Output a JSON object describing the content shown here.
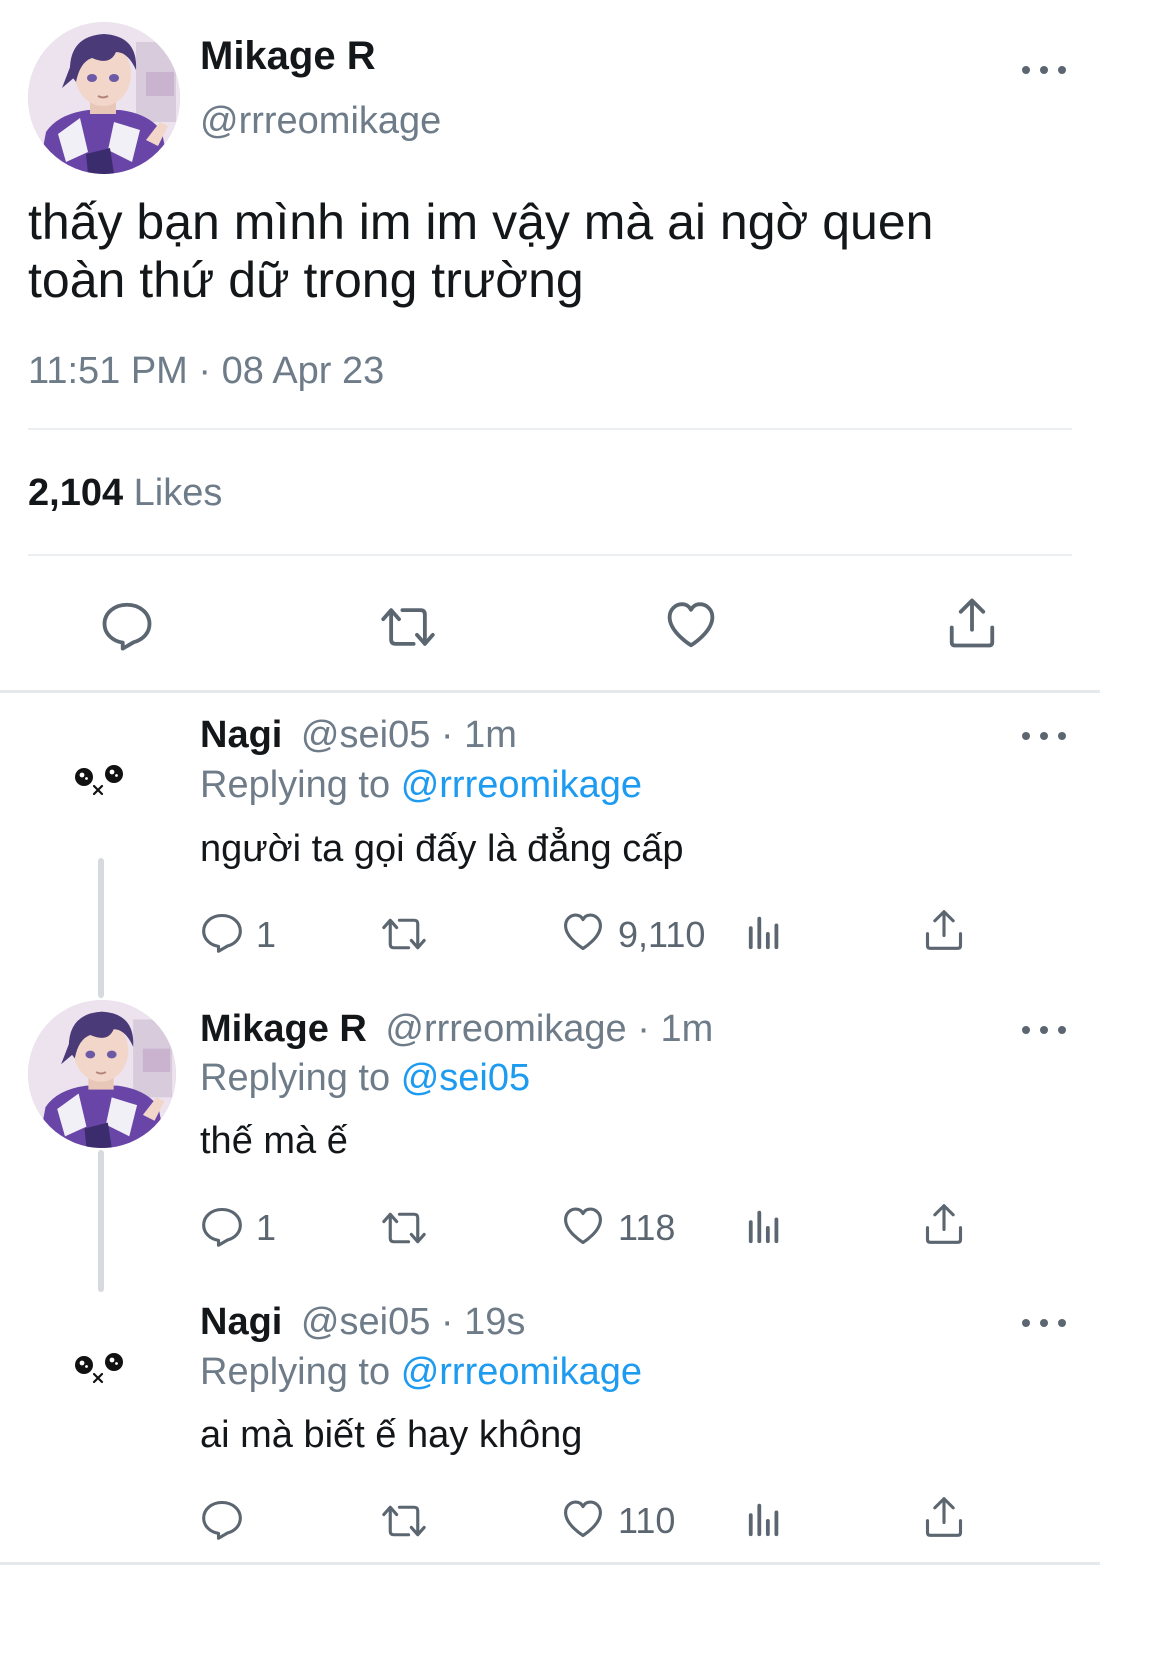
{
  "main_tweet": {
    "display_name": "Mikage R",
    "handle": "@rrreomikage",
    "text_line1": "thấy bạn mình im im vậy mà ai ngờ quen",
    "text_line2": "toàn thứ dữ trong trường",
    "timestamp": "11:51 PM · 08 Apr 23",
    "likes_count": "2,104",
    "likes_label": "Likes"
  },
  "replies": [
    {
      "display_name": "Nagi",
      "meta": "@sei05 · 1m",
      "replying_prefix": "Replying to",
      "replying_handle": "@rrreomikage",
      "text": "người ta gọi đấy là đẳng cấp",
      "reply_count": "1",
      "like_count": "9,110"
    },
    {
      "display_name": "Mikage R",
      "meta": "@rrreomikage · 1m",
      "replying_prefix": "Replying to",
      "replying_handle": "@sei05",
      "text": "thế mà ế",
      "reply_count": "1",
      "like_count": "118"
    },
    {
      "display_name": "Nagi",
      "meta": "@sei05 · 19s",
      "replying_prefix": "Replying to",
      "replying_handle": "@rrreomikage",
      "text": "ai mà biết ế hay không",
      "reply_count": "",
      "like_count": "110"
    }
  ],
  "colors": {
    "link_blue": "#1d9bf0",
    "secondary_gray": "#6e7b88",
    "icon_gray": "#5b6671"
  },
  "icons": [
    "more-icon",
    "reply-icon",
    "retweet-icon",
    "like-icon",
    "share-icon",
    "analytics-icon"
  ]
}
